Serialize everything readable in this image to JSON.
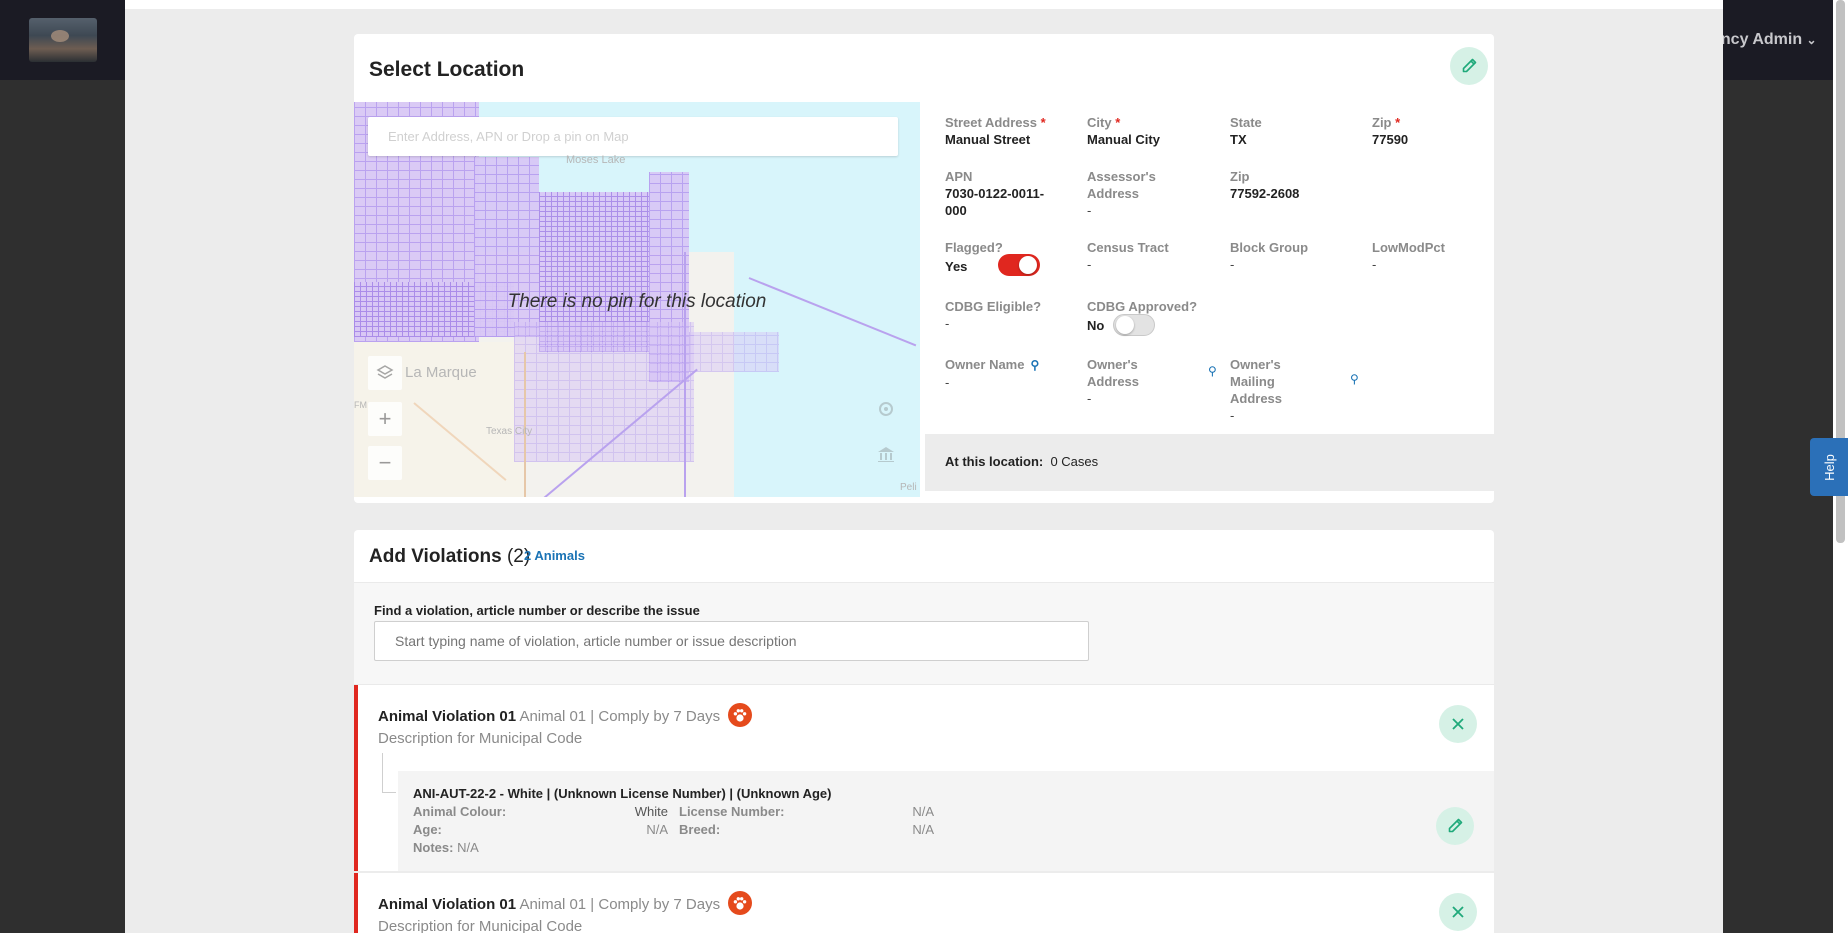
{
  "app": {
    "user_menu": "ency Admin"
  },
  "location": {
    "title": "Select Location",
    "search_placeholder": "Enter Address, APN or Drop a pin on Map",
    "no_pin_text": "There is no pin for this location",
    "map_labels": {
      "la_marque": "La Marque",
      "texas_city": "Texas City",
      "fm": "FM",
      "moses_lake": "Moses Lake",
      "pelican": "Peli"
    },
    "fields": {
      "street_label": "Street Address",
      "street_value": "Manual Street",
      "city_label": "City",
      "city_value": "Manual City",
      "state_label": "State",
      "state_value": "TX",
      "zip_label": "Zip",
      "zip_value": "77590",
      "apn_label": "APN",
      "apn_value": "7030-0122-0011-000",
      "assessor_label": "Assessor's Address",
      "assessor_value": "-",
      "zip2_label": "Zip",
      "zip2_value": "77592-2608",
      "flagged_label": "Flagged?",
      "flagged_value": "Yes",
      "census_label": "Census Tract",
      "census_value": "-",
      "block_label": "Block Group",
      "block_value": "-",
      "lowmod_label": "LowModPct",
      "lowmod_value": "-",
      "cdbg_elig_label": "CDBG Eligible?",
      "cdbg_elig_value": "-",
      "cdbg_appr_label": "CDBG Approved?",
      "cdbg_appr_value": "No",
      "owner_name_label": "Owner Name",
      "owner_name_value": "-",
      "owner_addr_label": "Owner's Address",
      "owner_addr_value": "-",
      "owner_mail_label": "Owner's Mailing Address",
      "owner_mail_value": "-"
    },
    "required_mark": "*",
    "at_location_label": "At this location:",
    "at_location_value": "0 Cases"
  },
  "violations": {
    "title": "Add Violations",
    "count": "(2)",
    "animals_link": "2 Animals",
    "search_label": "Find a violation, article number or describe the issue",
    "search_placeholder": "Start typing name of violation, article number or issue description",
    "items": [
      {
        "name": "Animal Violation 01",
        "sub": "Animal 01 | Comply by 7 Days",
        "desc": "Description for Municipal Code",
        "animal": {
          "title": "ANI-AUT-22-2 - White | (Unknown License Number) | (Unknown Age)",
          "colour_label": "Animal Colour:",
          "colour_value": "White",
          "license_label": "License Number:",
          "license_value": "N/A",
          "age_label": "Age:",
          "age_value": "N/A",
          "breed_label": "Breed:",
          "breed_value": "N/A",
          "notes_label": "Notes:",
          "notes_value": "N/A"
        }
      },
      {
        "name": "Animal Violation 01",
        "sub": "Animal 01 | Comply by 7 Days",
        "desc": "Description for Municipal Code"
      }
    ]
  },
  "help_tab": "Help",
  "colors": {
    "accent_red": "#e0271f",
    "link_blue": "#1a73b5",
    "green_btn_bg": "#d6f1e6",
    "green_icon": "#1fa97a"
  }
}
